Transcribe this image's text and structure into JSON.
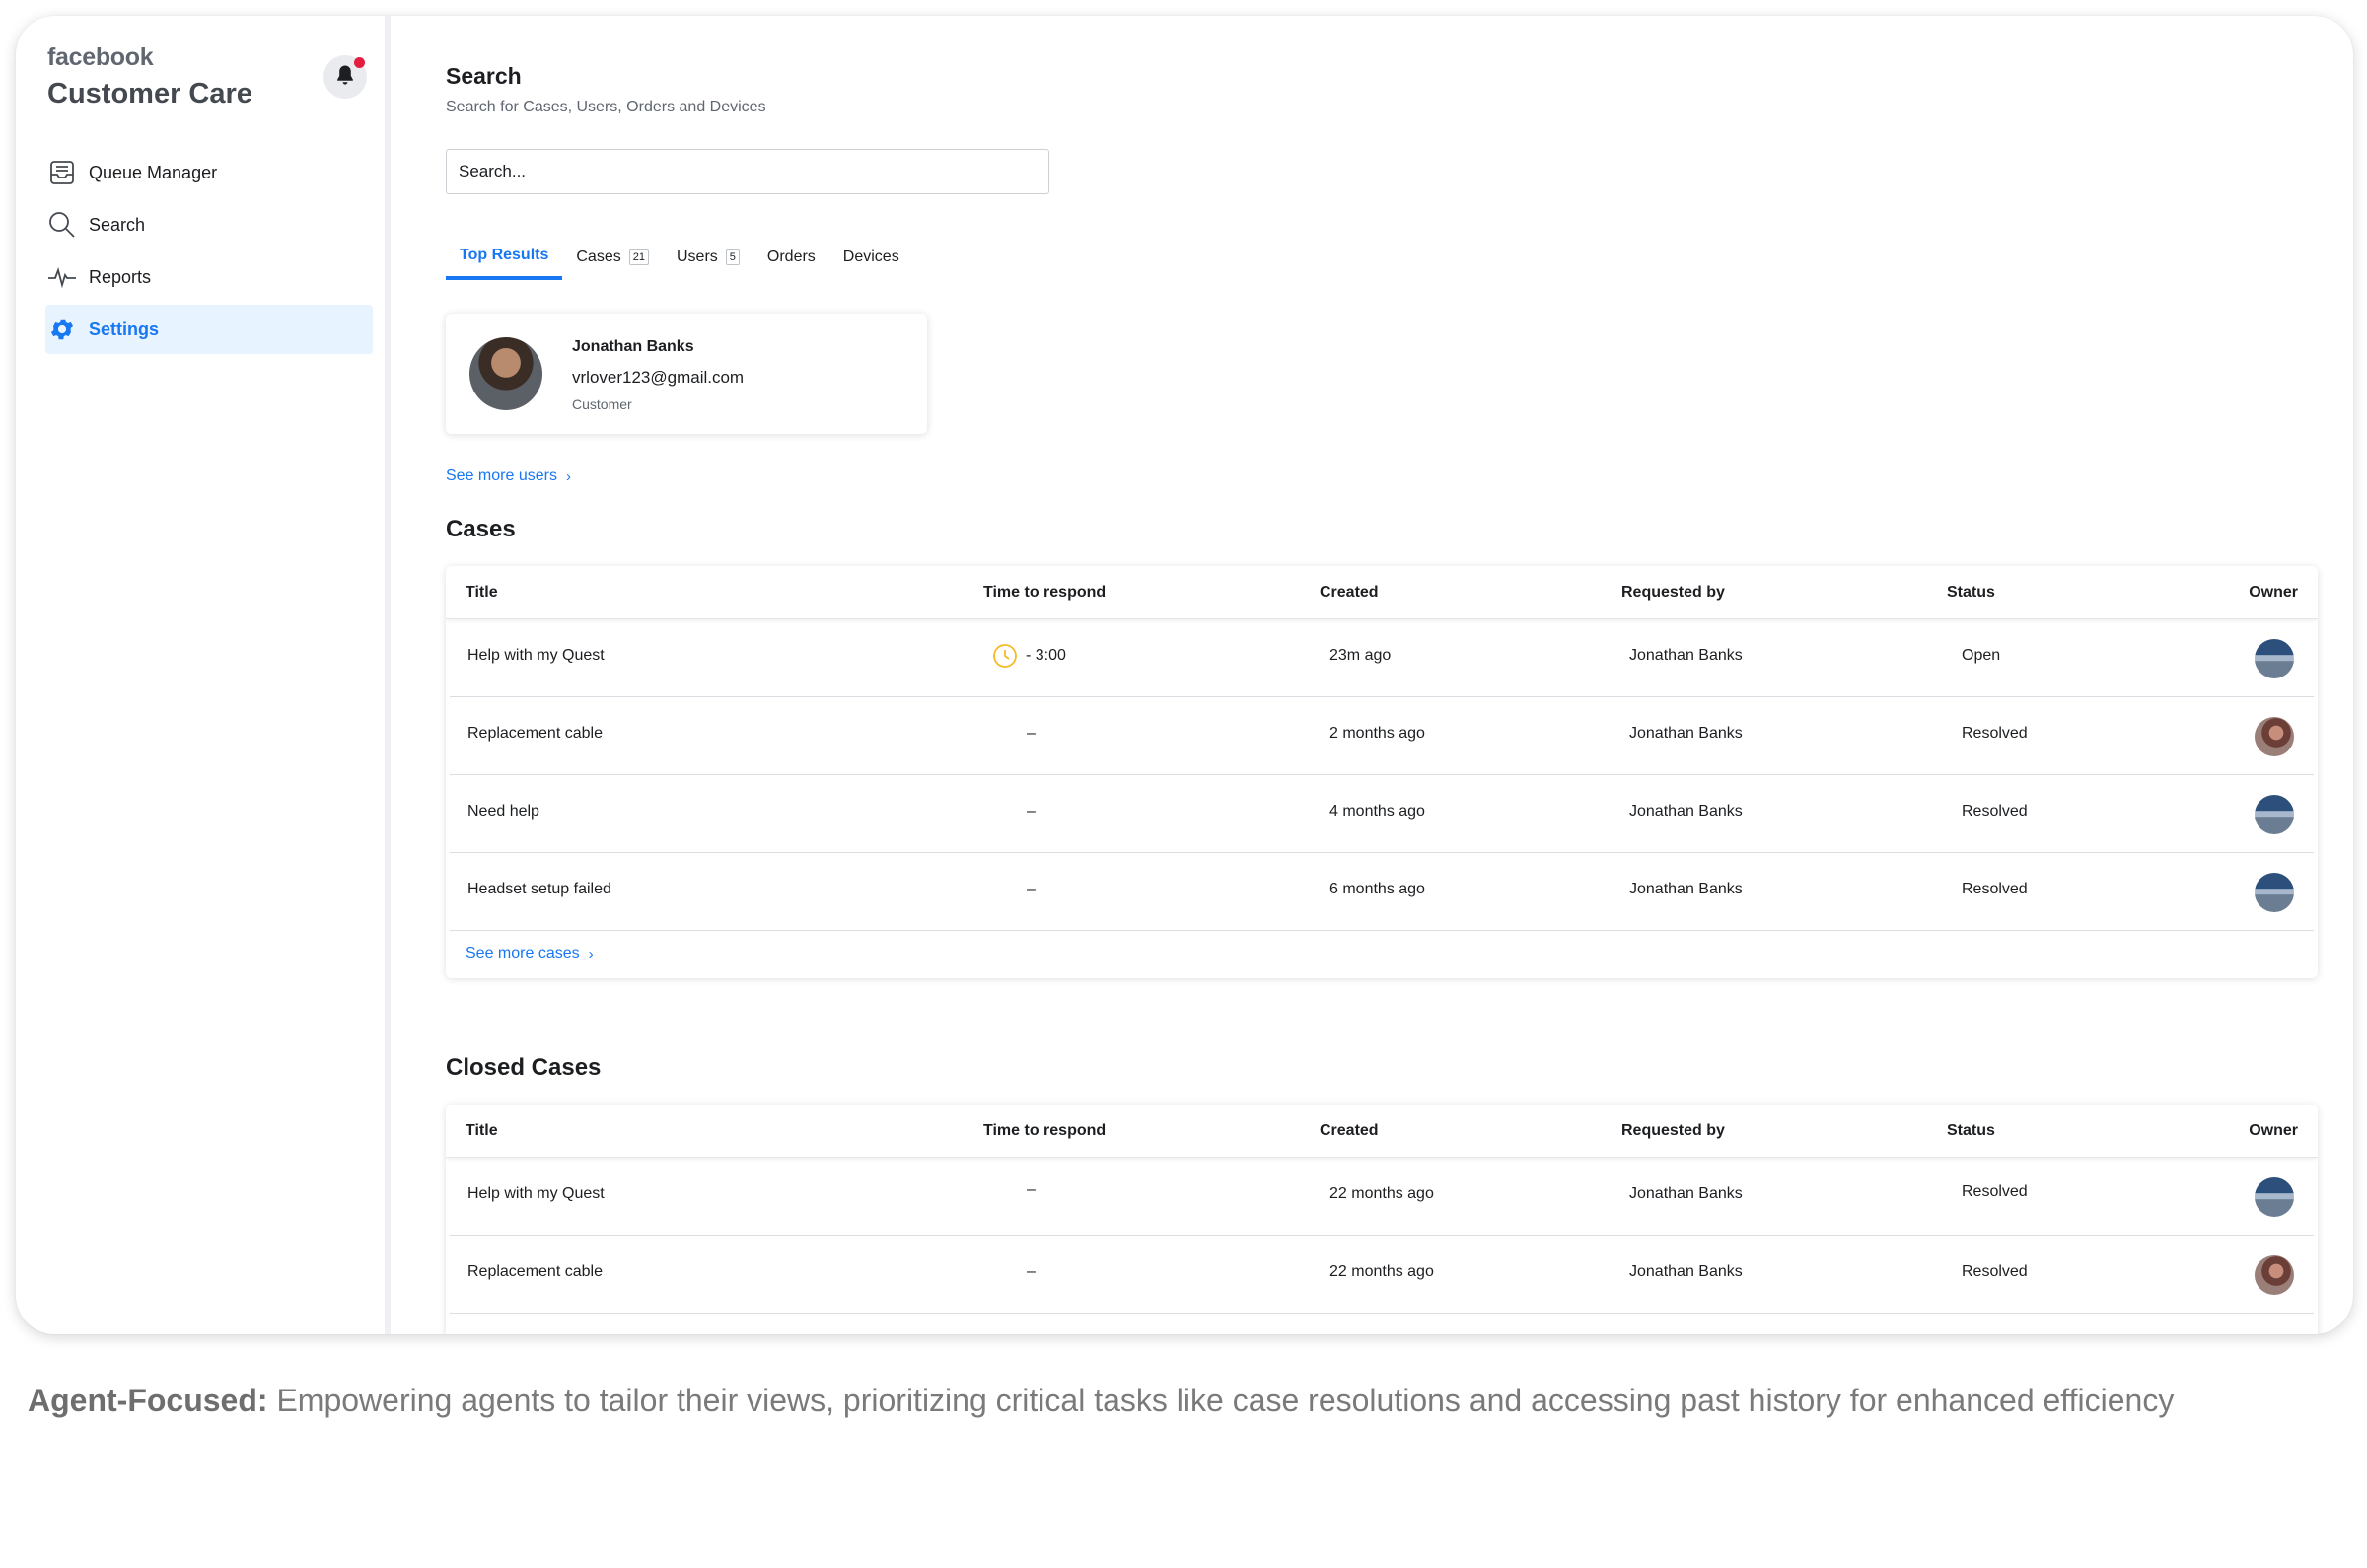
{
  "brand": {
    "company": "facebook",
    "product": "Customer Care"
  },
  "sidebar": {
    "items": [
      {
        "label": "Queue Manager",
        "icon": "inbox-icon",
        "active": false
      },
      {
        "label": "Search",
        "icon": "search-icon",
        "active": false
      },
      {
        "label": "Reports",
        "icon": "pulse-icon",
        "active": false
      },
      {
        "label": "Settings",
        "icon": "gear-icon",
        "active": true
      }
    ]
  },
  "header": {
    "title": "Search",
    "subtitle": "Search for Cases, Users, Orders and Devices"
  },
  "search": {
    "placeholder": "Search..."
  },
  "tabs": [
    {
      "label": "Top Results",
      "count": ""
    },
    {
      "label": "Cases",
      "count": "21"
    },
    {
      "label": "Users",
      "count": "5"
    },
    {
      "label": "Orders",
      "count": ""
    },
    {
      "label": "Devices",
      "count": ""
    }
  ],
  "user_card": {
    "name": "Jonathan Banks",
    "email": "vrlover123@gmail.com",
    "role": "Customer"
  },
  "see_more_users": "See more users",
  "table_headers": {
    "title": "Title",
    "time": "Time to respond",
    "created": "Created",
    "requested": "Requested by",
    "status": "Status",
    "owner": "Owner"
  },
  "cases": {
    "title": "Cases",
    "rows": [
      {
        "title": "Help with my Quest",
        "time": "- 3:00",
        "created": "23m ago",
        "requested": "Jonathan Banks",
        "status": "Open",
        "owner": "blue"
      },
      {
        "title": "Replacement cable",
        "time": "–",
        "created": "2 months ago",
        "requested": "Jonathan Banks",
        "status": "Resolved",
        "owner": "brown"
      },
      {
        "title": "Need help",
        "time": "–",
        "created": "4 months ago",
        "requested": "Jonathan Banks",
        "status": "Resolved",
        "owner": "blue"
      },
      {
        "title": "Headset setup failed",
        "time": "–",
        "created": "6 months ago",
        "requested": "Jonathan Banks",
        "status": "Resolved",
        "owner": "blue"
      }
    ],
    "see_more": "See more cases"
  },
  "closed_cases": {
    "title": "Closed Cases",
    "rows": [
      {
        "title": "Help with my Quest",
        "time": "–",
        "created": "22 months ago",
        "requested": "Jonathan Banks",
        "status": "Resolved",
        "owner": "blue"
      },
      {
        "title": "Replacement cable",
        "time": "–",
        "created": "22 months ago",
        "requested": "Jonathan Banks",
        "status": "Resolved",
        "owner": "brown"
      }
    ]
  },
  "caption": {
    "lead": "Agent-Focused:",
    "text": "Empowering agents to tailor their views, prioritizing critical tasks like case resolutions and accessing past history for enhanced efficiency"
  },
  "colors": {
    "accent": "#1877f2",
    "active_bg": "#e7f3ff",
    "notification": "#e41e3f",
    "clock": "#f7b928"
  }
}
